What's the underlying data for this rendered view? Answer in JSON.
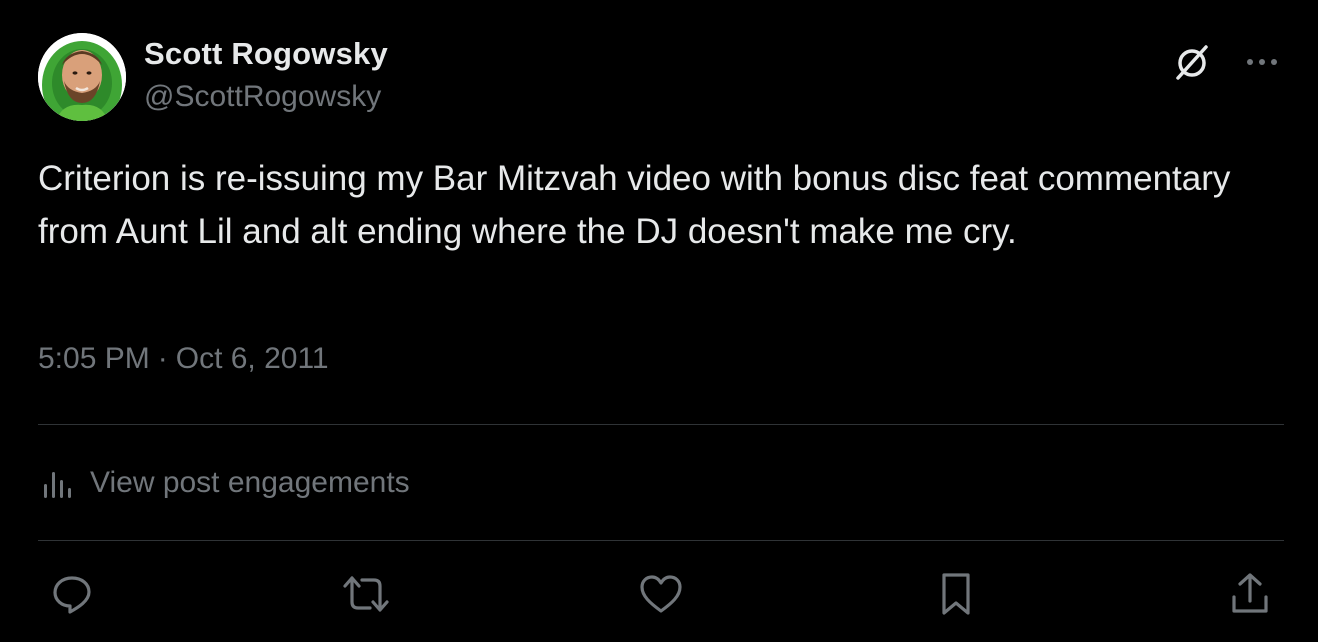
{
  "author": {
    "display_name": "Scott Rogowsky",
    "handle": "@ScottRogowsky"
  },
  "post": {
    "text": "Criterion is re-issuing my Bar Mitzvah video with bonus disc feat commentary from Aunt Lil and alt ending where the DJ doesn't make me cry.",
    "time": "5:05 PM",
    "separator": "·",
    "date": "Oct 6, 2011"
  },
  "engagements": {
    "label": "View post engagements",
    "icon": "analytics-icon"
  },
  "actions": [
    {
      "name": "reply",
      "icon": "reply-icon"
    },
    {
      "name": "repost",
      "icon": "repost-icon"
    },
    {
      "name": "like",
      "icon": "heart-icon"
    },
    {
      "name": "bookmark",
      "icon": "bookmark-icon"
    },
    {
      "name": "share",
      "icon": "share-icon"
    }
  ],
  "colors": {
    "background": "#000000",
    "primary_text": "#e7e9ea",
    "secondary_text": "#71767b",
    "divider": "#2f3336",
    "avatar_accent": "#3fa535"
  }
}
